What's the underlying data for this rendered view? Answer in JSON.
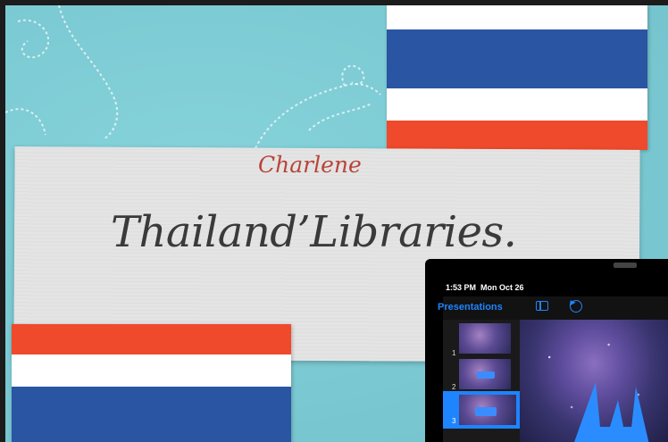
{
  "slide": {
    "author": "Charlene",
    "title": "Thailand’Libraries.",
    "flag_colors": {
      "red": "#ef4a2c",
      "white": "#ffffff",
      "blue": "#2a55a3"
    },
    "background_color": "#7ccad3"
  },
  "ipad_overlay": {
    "status_time": "1:53 PM",
    "status_date": "Mon Oct 26",
    "toolbar": {
      "presentations_label": "Presentations",
      "sidebar_icon": "sidebar-icon",
      "undo_icon": "undo-icon"
    },
    "accent_color": "#1e84ff",
    "slides": [
      {
        "number": "1",
        "selected": false
      },
      {
        "number": "2",
        "selected": false
      },
      {
        "number": "3",
        "selected": true
      }
    ]
  }
}
